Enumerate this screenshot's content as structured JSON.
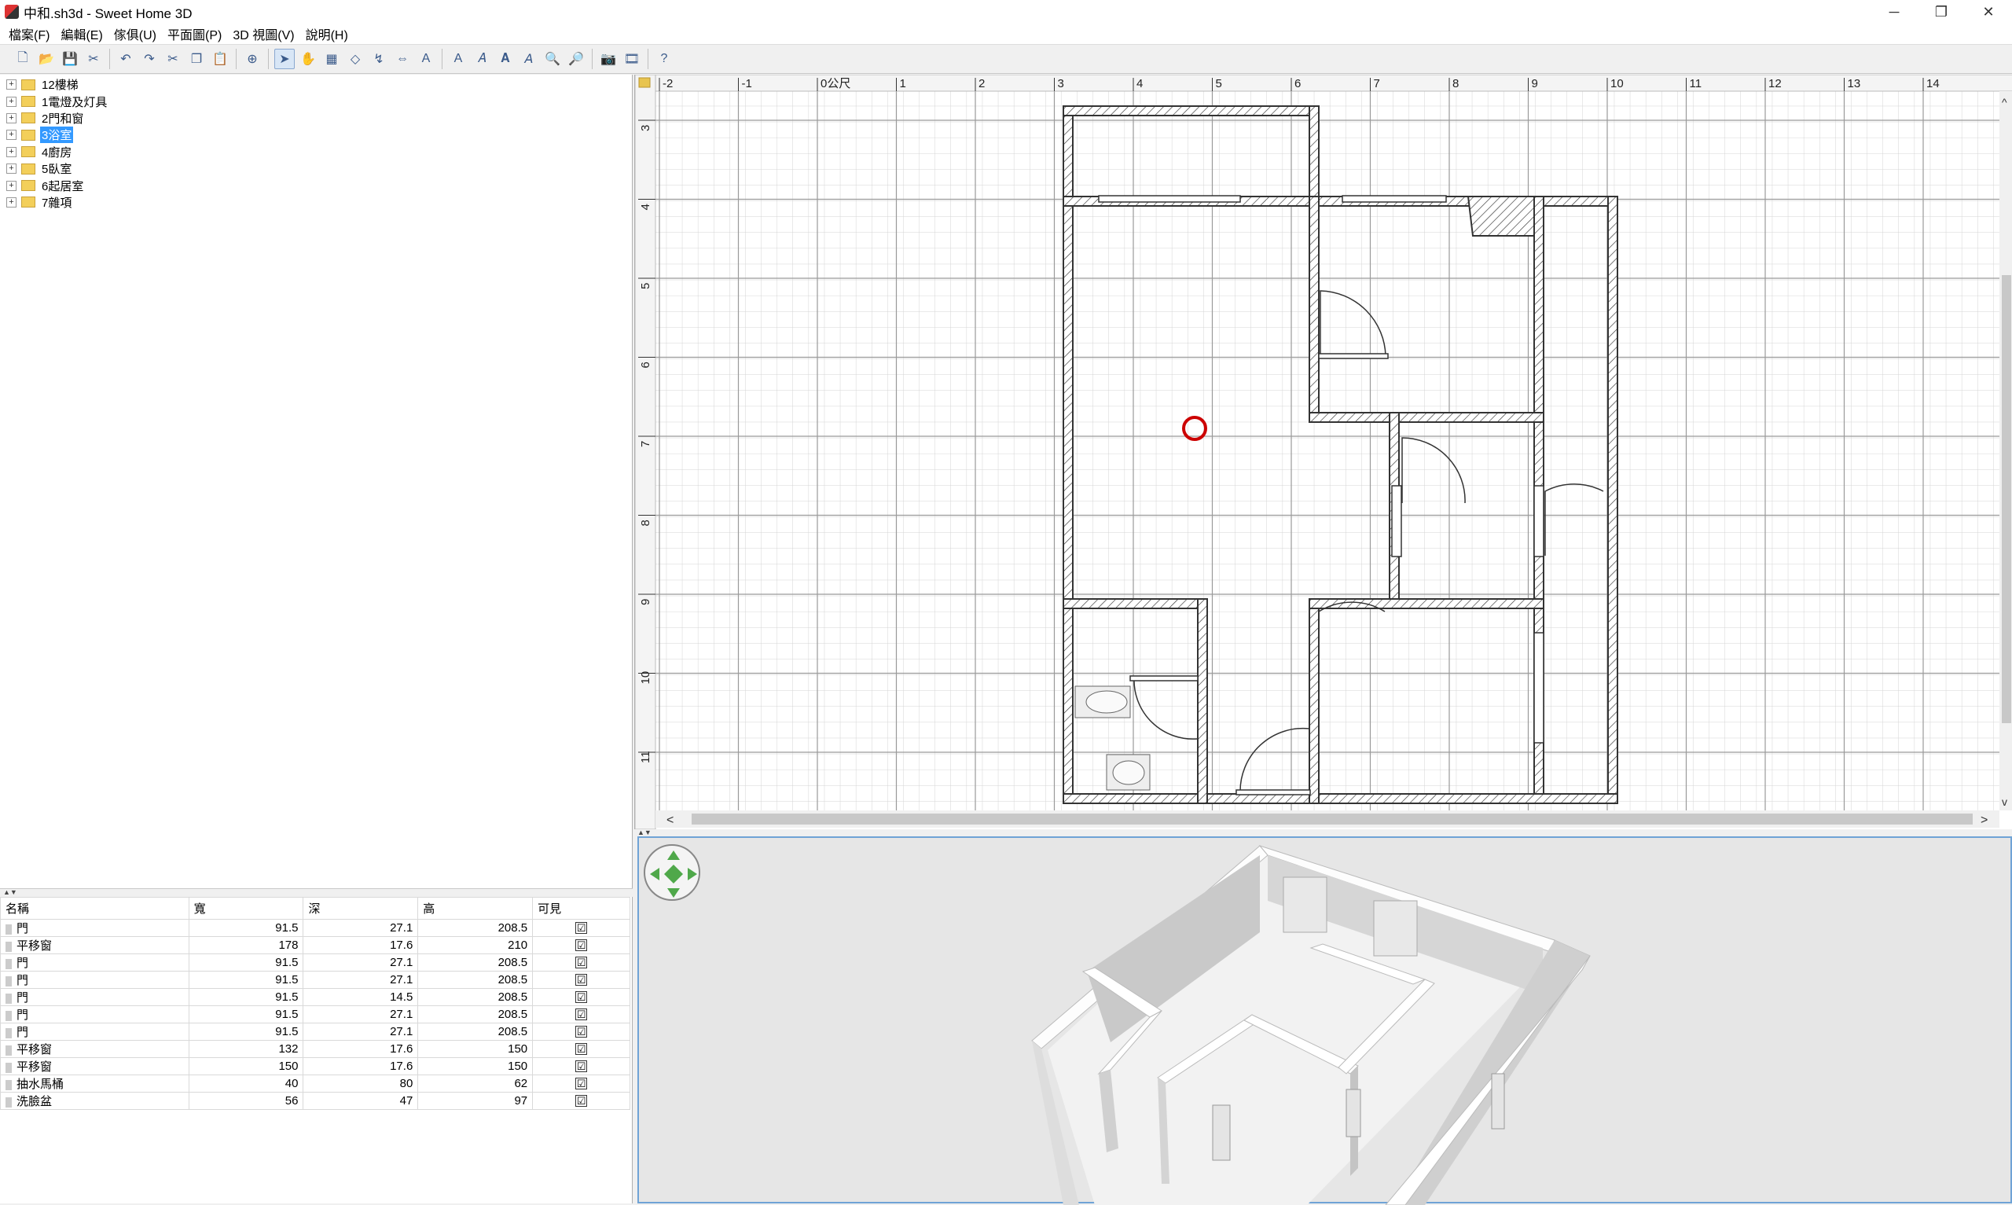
{
  "window": {
    "title": "中和.sh3d - Sweet Home 3D",
    "minimize": "─",
    "restore": "❐",
    "close": "✕"
  },
  "menu": [
    "檔案(F)",
    "編輯(E)",
    "傢俱(U)",
    "平面圖(P)",
    "3D 視圖(V)",
    "說明(H)"
  ],
  "toolbar_icons": [
    "new-icon",
    "open-icon",
    "save-icon",
    "cut-file-icon",
    "undo-icon",
    "redo-icon",
    "cut-icon",
    "copy-icon",
    "paste-icon",
    "add-furniture-icon",
    "select-icon",
    "pan-icon",
    "create-walls-icon",
    "create-rooms-icon",
    "create-polylines-icon",
    "create-dimensions-icon",
    "add-text-icon",
    "rotate-text-icon",
    "italic-icon",
    "bold-icon",
    "modify-text-icon",
    "zoom-in-icon",
    "zoom-out-icon",
    "create-photo-icon",
    "create-video-icon",
    "help-icon"
  ],
  "catalog": [
    {
      "label": "12樓梯",
      "selected": false
    },
    {
      "label": "1電燈及灯具",
      "selected": false
    },
    {
      "label": "2門和窗",
      "selected": false
    },
    {
      "label": "3浴室",
      "selected": true
    },
    {
      "label": "4廚房",
      "selected": false
    },
    {
      "label": "5臥室",
      "selected": false
    },
    {
      "label": "6起居室",
      "selected": false
    },
    {
      "label": "7雜項",
      "selected": false
    }
  ],
  "furniture_table": {
    "headers": [
      "名稱",
      "寬",
      "深",
      "高",
      "可見"
    ],
    "rows": [
      [
        "門",
        "91.5",
        "27.1",
        "208.5",
        "☑"
      ],
      [
        "平移窗",
        "178",
        "17.6",
        "210",
        "☑"
      ],
      [
        "門",
        "91.5",
        "27.1",
        "208.5",
        "☑"
      ],
      [
        "門",
        "91.5",
        "27.1",
        "208.5",
        "☑"
      ],
      [
        "門",
        "91.5",
        "14.5",
        "208.5",
        "☑"
      ],
      [
        "門",
        "91.5",
        "27.1",
        "208.5",
        "☑"
      ],
      [
        "門",
        "91.5",
        "27.1",
        "208.5",
        "☑"
      ],
      [
        "平移窗",
        "132",
        "17.6",
        "150",
        "☑"
      ],
      [
        "平移窗",
        "150",
        "17.6",
        "150",
        "☑"
      ],
      [
        "抽水馬桶",
        "40",
        "80",
        "62",
        "☑"
      ],
      [
        "洗臉盆",
        "56",
        "47",
        "97",
        "☑"
      ]
    ]
  },
  "plan": {
    "x_ruler": [
      "-2",
      "-1",
      "0公尺",
      "1",
      "2",
      "3",
      "4",
      "5",
      "6",
      "7",
      "8",
      "9",
      "10",
      "11",
      "12",
      "13",
      "14"
    ],
    "y_ruler": [
      "3",
      "4",
      "5",
      "6",
      "7",
      "8",
      "9",
      "10",
      "11"
    ],
    "scroll_left": "<",
    "scroll_right": ">",
    "scroll_up": "^",
    "scroll_down": "v"
  },
  "colors": {
    "accent": "#3399ff",
    "marker": "#cc0000",
    "grid": "#c8c8c8",
    "wall": "#333333"
  }
}
